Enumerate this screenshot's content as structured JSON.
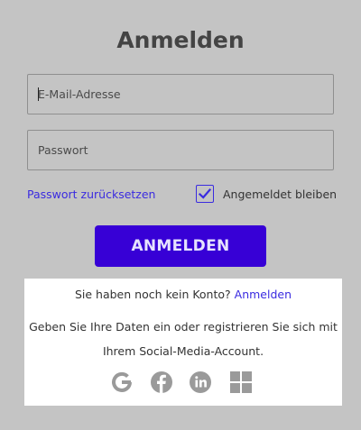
{
  "title": "Anmelden",
  "email": {
    "placeholder": "E-Mail-Adresse",
    "value": ""
  },
  "password": {
    "placeholder": "Passwort",
    "value": ""
  },
  "reset_password_label": "Passwort zurücksetzen",
  "remember_me": {
    "label": "Angemeldet bleiben",
    "checked": true
  },
  "login_button_label": "ANMELDEN",
  "signup_panel": {
    "no_account_text": "Sie haben noch kein Konto?",
    "register_link_label": "Anmelden",
    "info_text": "Geben Sie Ihre Daten ein oder registrieren Sie sich mit Ihrem Social-Media-Account."
  },
  "social_icons": [
    "google-icon",
    "facebook-icon",
    "linkedin-icon",
    "microsoft-icon"
  ],
  "colors": {
    "accent": "#3700d6",
    "link": "#3a2be0",
    "background": "#c4c4c4",
    "icon": "#9a9a9a"
  }
}
